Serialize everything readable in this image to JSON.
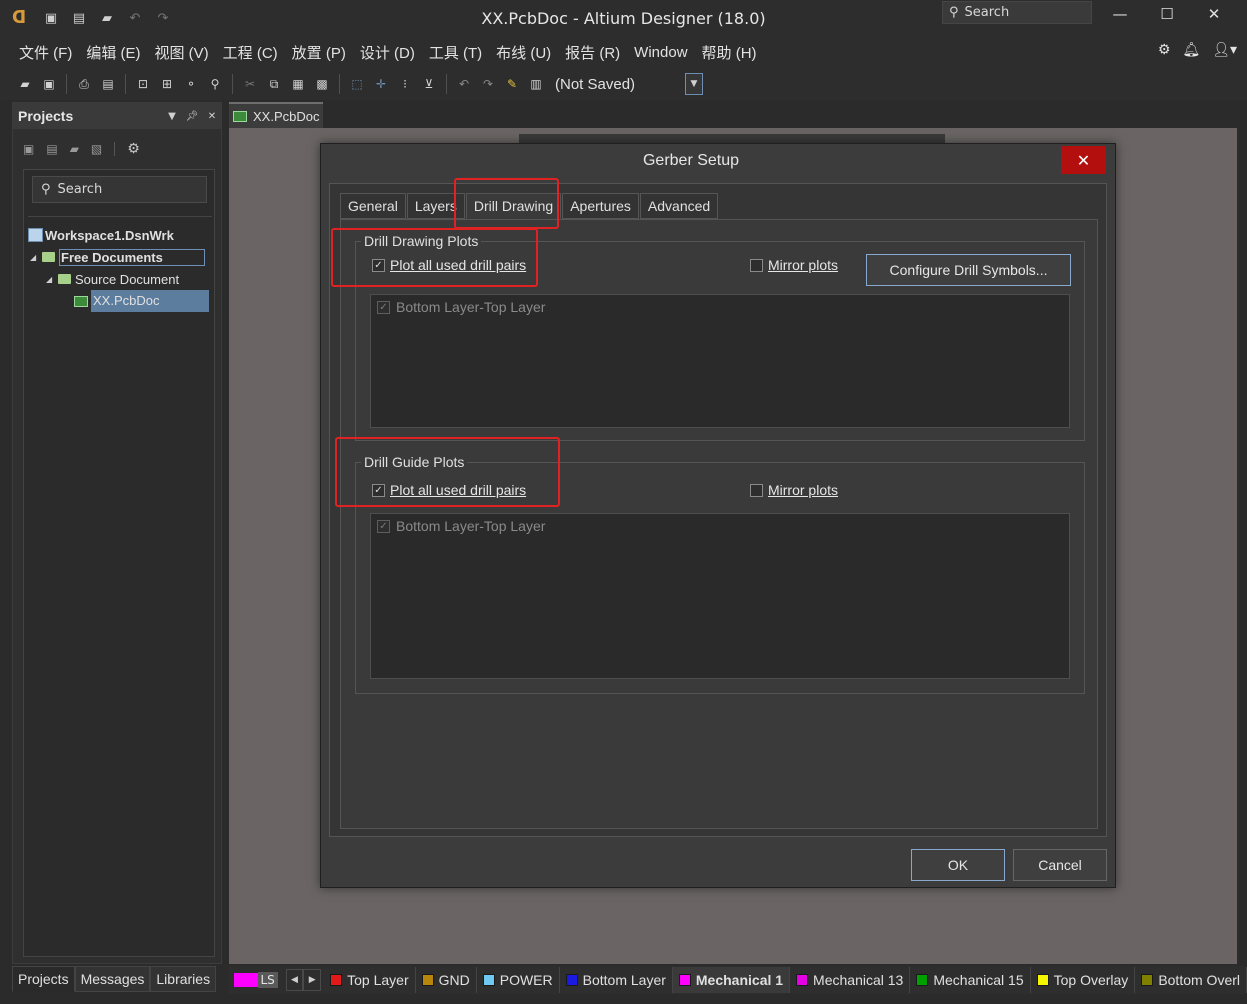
{
  "window": {
    "title": "XX.PcbDoc - Altium Designer (18.0)",
    "search_label": "Search"
  },
  "menu": {
    "items": [
      "文件 (F)",
      "编辑 (E)",
      "视图 (V)",
      "工程 (C)",
      "放置 (P)",
      "设计 (D)",
      "工具 (T)",
      "布线 (U)",
      "报告 (R)",
      "Window",
      "帮助 (H)"
    ]
  },
  "toolbar": {
    "document_status": "(Not Saved)"
  },
  "projects_panel": {
    "title": "Projects",
    "search_placeholder": "Search",
    "tree": {
      "workspace": "Workspace1.DsnWrk",
      "project": "Free Documents",
      "folder": "Source Document",
      "document": "XX.PcbDoc"
    }
  },
  "bottom_tabs": [
    "Projects",
    "Messages",
    "Libraries"
  ],
  "document_tab": "XX.PcbDoc",
  "dialog": {
    "title": "Gerber Setup",
    "tabs": [
      "General",
      "Layers",
      "Drill Drawing",
      "Apertures",
      "Advanced"
    ],
    "active_tab": "Drill Drawing",
    "drill_drawing": {
      "title": "Drill Drawing Plots",
      "plot_all_label": "Plot all used drill pairs",
      "plot_all_checked": true,
      "mirror_label": "Mirror plots",
      "mirror_checked": false,
      "configure_button": "Configure Drill Symbols...",
      "list_item": "Bottom Layer-Top Layer"
    },
    "drill_guide": {
      "title": "Drill Guide Plots",
      "plot_all_label": "Plot all used drill pairs",
      "plot_all_checked": true,
      "mirror_label": "Mirror plots",
      "mirror_checked": false,
      "list_item": "Bottom Layer-Top Layer"
    },
    "ok_button": "OK",
    "cancel_button": "Cancel"
  },
  "layer_strip": {
    "ls_label": "LS",
    "ls_color": "#ff00ff",
    "layers": [
      {
        "name": "Top Layer",
        "color": "#e31a1a"
      },
      {
        "name": "GND",
        "color": "#b8860b"
      },
      {
        "name": "POWER",
        "color": "#6fc8f0"
      },
      {
        "name": "Bottom Layer",
        "color": "#1a1ae3"
      },
      {
        "name": "Mechanical 1",
        "color": "#ff00ff",
        "active": true
      },
      {
        "name": "Mechanical 13",
        "color": "#e600e6"
      },
      {
        "name": "Mechanical 15",
        "color": "#00a000"
      },
      {
        "name": "Top Overlay",
        "color": "#f5f500"
      },
      {
        "name": "Bottom Overl",
        "color": "#808000"
      }
    ]
  }
}
